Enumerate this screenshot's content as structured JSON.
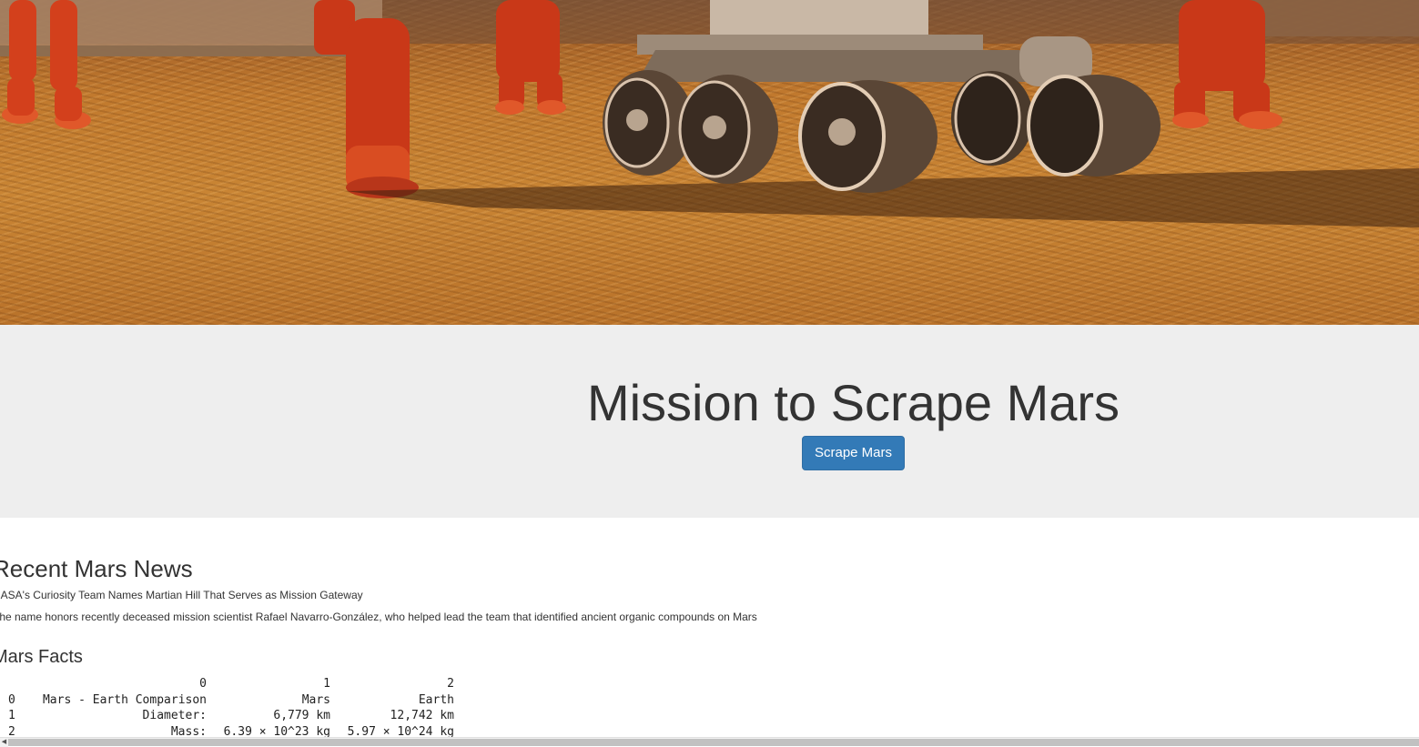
{
  "hero": {
    "image_name": "mars-rover-astronauts-image"
  },
  "jumbotron": {
    "title": "Mission to Scrape Mars",
    "button_label": "Scrape Mars",
    "button_color": "#337ab7"
  },
  "news": {
    "heading": "Recent Mars News",
    "title": "NASA's Curiosity Team Names Martian Hill That Serves as Mission Gateway",
    "paragraph": "The name honors recently deceased mission scientist Rafael Navarro-González, who helped lead the team that identified ancient organic compounds on Mars"
  },
  "facts": {
    "heading": "Mars Facts",
    "columns": [
      "",
      "0",
      "1",
      "2"
    ],
    "rows": [
      [
        "0",
        "Mars - Earth Comparison",
        "Mars",
        "Earth"
      ],
      [
        "1",
        "Diameter:",
        "6,779 km",
        "12,742 km"
      ],
      [
        "2",
        "Mass:",
        "6.39 × 10^23 kg",
        "5.97 × 10^24 kg"
      ]
    ]
  },
  "scrollbar": {
    "arrow_icon": "scroll-left-arrow-icon"
  }
}
